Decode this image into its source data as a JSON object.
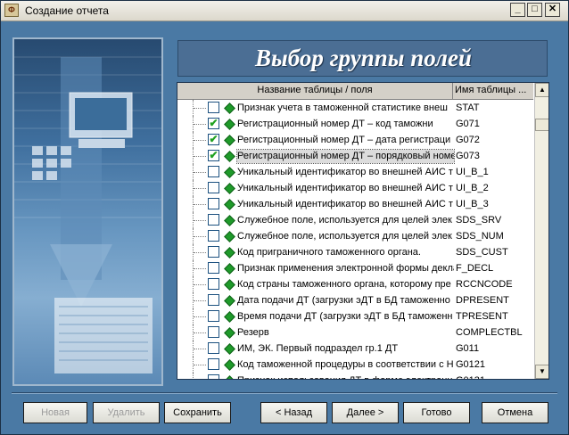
{
  "window": {
    "title": "Создание отчета",
    "controls": {
      "minimize": "_",
      "maximize": "□",
      "close": "✕"
    }
  },
  "header": {
    "title": "Выбор группы полей"
  },
  "grid": {
    "columns": [
      "Название таблицы / поля",
      "Имя таблицы ..."
    ],
    "rows": [
      {
        "checked": false,
        "name": "Признак учета в таможенной статистике внеш",
        "table": "STAT",
        "selected": false
      },
      {
        "checked": true,
        "name": "Регистрационный номер ДТ – код таможни",
        "table": "G071",
        "selected": false
      },
      {
        "checked": true,
        "name": "Регистрационный номер ДТ – дата регистраци",
        "table": "G072",
        "selected": false
      },
      {
        "checked": true,
        "name": "Регистрационный номер ДТ – порядковый номе",
        "table": "G073",
        "selected": true
      },
      {
        "checked": false,
        "name": "Уникальный идентификатор во внешней АИС т",
        "table": "UI_B_1",
        "selected": false
      },
      {
        "checked": false,
        "name": "Уникальный идентификатор во внешней АИС т",
        "table": "UI_B_2",
        "selected": false
      },
      {
        "checked": false,
        "name": "Уникальный идентификатор во внешней АИС т",
        "table": "UI_B_3",
        "selected": false
      },
      {
        "checked": false,
        "name": "Служебное поле, используется для целей элек",
        "table": "SDS_SRV",
        "selected": false
      },
      {
        "checked": false,
        "name": "Служебное поле, используется для целей элек",
        "table": "SDS_NUM",
        "selected": false
      },
      {
        "checked": false,
        "name": "Код приграничного таможенного органа.",
        "table": "SDS_CUST",
        "selected": false
      },
      {
        "checked": false,
        "name": "Признак применения электронной формы декла",
        "table": "F_DECL",
        "selected": false
      },
      {
        "checked": false,
        "name": "Код страны таможенного органа, которому пре",
        "table": "RCCNCODE",
        "selected": false
      },
      {
        "checked": false,
        "name": "Дата подачи ДТ (загрузки эДТ в БД таможенно",
        "table": "DPRESENT",
        "selected": false
      },
      {
        "checked": false,
        "name": "Время подачи ДТ (загрузки эДТ в БД таможенн",
        "table": "TPRESENT",
        "selected": false
      },
      {
        "checked": false,
        "name": "Резерв",
        "table": "COMPLECTBL",
        "selected": false
      },
      {
        "checked": false,
        "name": "ИМ, ЭК. Первый подраздел гр.1 ДТ",
        "table": "G011",
        "selected": false
      },
      {
        "checked": false,
        "name": "Код таможенной процедуры в соответствии с Н",
        "table": "G0121",
        "selected": false
      },
      {
        "checked": false,
        "name": "Признак использования ДТ в форме электронн",
        "table": "G0131",
        "selected": false
      }
    ]
  },
  "buttons": {
    "new": "Новая",
    "delete": "Удалить",
    "save": "Сохранить",
    "back": "< Назад",
    "next": "Далее >",
    "finish": "Готово",
    "cancel": "Отмена"
  },
  "colors": {
    "background": "#4a79a4",
    "header": "#4b6e94",
    "check": "#21a121",
    "diamond": "#1f9a2a"
  }
}
